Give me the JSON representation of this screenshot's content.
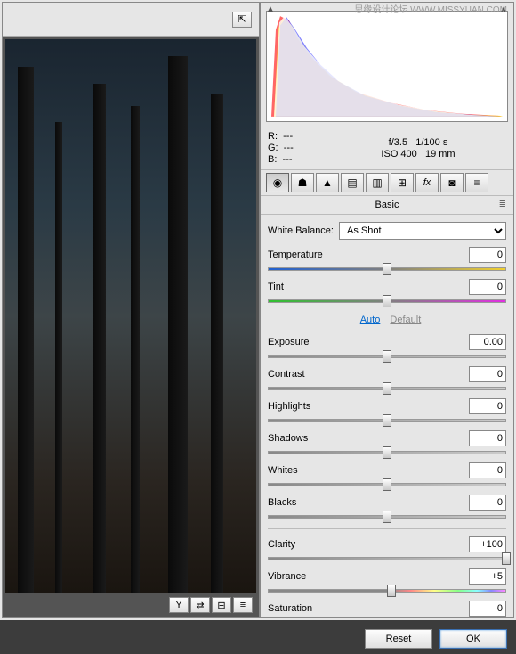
{
  "watermark": "思缘设计论坛  WWW.MISSYUAN.COM",
  "info": {
    "r_label": "R:",
    "r_value": "---",
    "g_label": "G:",
    "g_value": "---",
    "b_label": "B:",
    "b_value": "---",
    "aperture": "f/3.5",
    "shutter": "1/100 s",
    "iso": "ISO 400",
    "focal": "19 mm"
  },
  "panel_title": "Basic",
  "wb": {
    "label": "White Balance:",
    "value": "As Shot"
  },
  "links": {
    "auto": "Auto",
    "default": "Default"
  },
  "sliders": {
    "temperature": {
      "label": "Temperature",
      "value": "0",
      "pos": 50
    },
    "tint": {
      "label": "Tint",
      "value": "0",
      "pos": 50
    },
    "exposure": {
      "label": "Exposure",
      "value": "0.00",
      "pos": 50
    },
    "contrast": {
      "label": "Contrast",
      "value": "0",
      "pos": 50
    },
    "highlights": {
      "label": "Highlights",
      "value": "0",
      "pos": 50
    },
    "shadows": {
      "label": "Shadows",
      "value": "0",
      "pos": 50
    },
    "whites": {
      "label": "Whites",
      "value": "0",
      "pos": 50
    },
    "blacks": {
      "label": "Blacks",
      "value": "0",
      "pos": 50
    },
    "clarity": {
      "label": "Clarity",
      "value": "+100",
      "pos": 100
    },
    "vibrance": {
      "label": "Vibrance",
      "value": "+5",
      "pos": 52
    },
    "saturation": {
      "label": "Saturation",
      "value": "0",
      "pos": 50
    }
  },
  "buttons": {
    "reset": "Reset",
    "ok": "OK"
  }
}
